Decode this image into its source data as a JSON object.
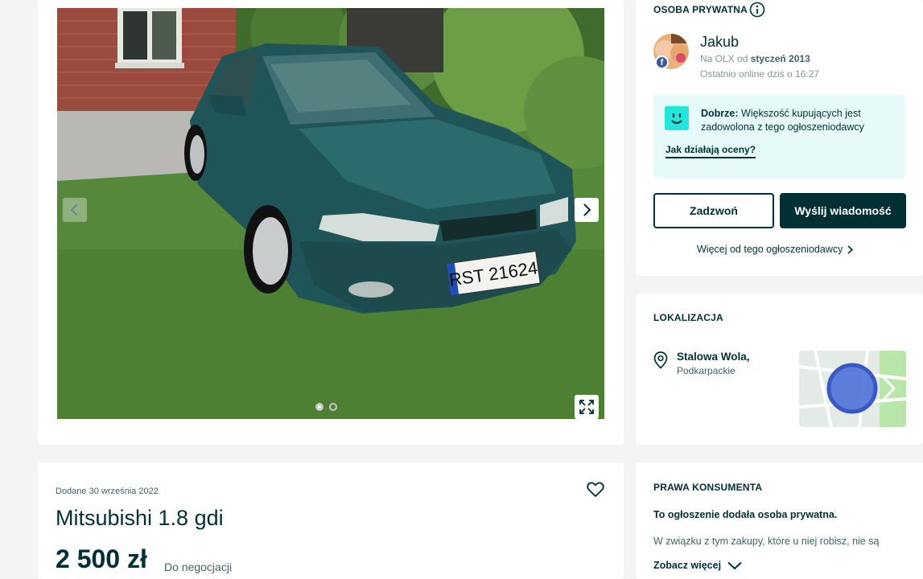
{
  "gallery": {
    "plate_text": "RST 21624",
    "slide_count": 2,
    "active_slide": 1
  },
  "seller": {
    "section_title": "OSOBA PRYWATNA",
    "name": "Jakub",
    "since_prefix": "Na OLX od",
    "since_date": "styczeń 2013",
    "last_online": "Ostatnio online dziś o 16:27",
    "rating_label": "Dobrze:",
    "rating_text": "Większość kupujących jest zadowolona z tego ogłoszeniodawcy",
    "rating_link": "Jak działają oceny?",
    "call_button": "Zadzwoń",
    "message_button": "Wyślij wiadomość",
    "more_link": "Więcej od tego ogłoszeniodawcy"
  },
  "location": {
    "section_title": "LOKALIZACJA",
    "city": "Stalowa Wola,",
    "region": "Podkarpackie"
  },
  "listing": {
    "date_added": "Dodane 30 września 2022",
    "title": "Mitsubishi 1.8 gdi",
    "price": "2 500 zł",
    "negotiable": "Do negocjacji"
  },
  "consumer_rights": {
    "section_title": "PRAWA KONSUMENTA",
    "bold_text": "To ogłoszenie dodała osoba prywatna.",
    "text": "W związku z tym zakupy, które u niej robisz, nie są",
    "see_more": "Zobacz więcej"
  },
  "colors": {
    "primary": "#002f34",
    "accent": "#23e5db",
    "rating_bg": "#e6fbf9",
    "page_bg": "#f2f4f5"
  },
  "icons": [
    "info-icon",
    "chevron-left-icon",
    "chevron-right-icon",
    "fullscreen-icon",
    "smile-icon",
    "location-pin-icon",
    "heart-icon",
    "chevron-down-icon"
  ]
}
